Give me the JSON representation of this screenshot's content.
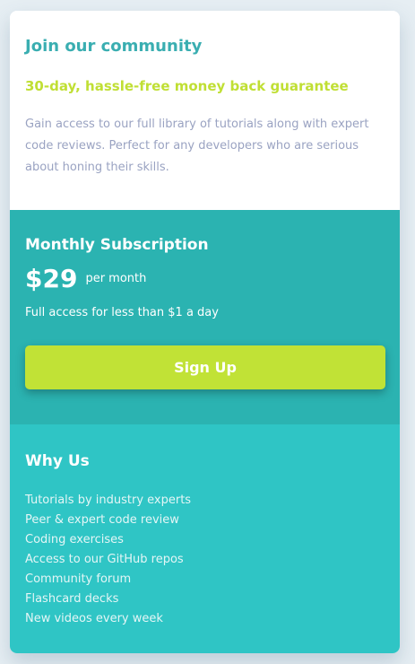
{
  "community": {
    "title": "Join our community",
    "guarantee": "30-day, hassle-free money back guarantee",
    "description": "Gain access to our full library of tutorials along with expert code reviews. Perfect for any developers who are serious about honing their skills."
  },
  "subscription": {
    "title": "Monthly Subscription",
    "price": "$29",
    "period": "per month",
    "access": "Full access for less than $1 a day",
    "button_label": "Sign Up"
  },
  "why": {
    "title": "Why Us",
    "items": [
      "Tutorials by industry experts",
      "Peer & expert code review",
      "Coding exercises",
      "Access to our GitHub repos",
      "Community forum",
      "Flashcard decks",
      "New videos every week"
    ]
  },
  "colors": {
    "page_background": "#e6eef3",
    "title_teal": "#3aaeb1",
    "guarantee_green": "#c0df34",
    "description_gray": "#9aa3c2",
    "subscription_bg": "#2bb3b1",
    "why_bg": "#2fc5c5",
    "button_bg": "#c1e236"
  }
}
